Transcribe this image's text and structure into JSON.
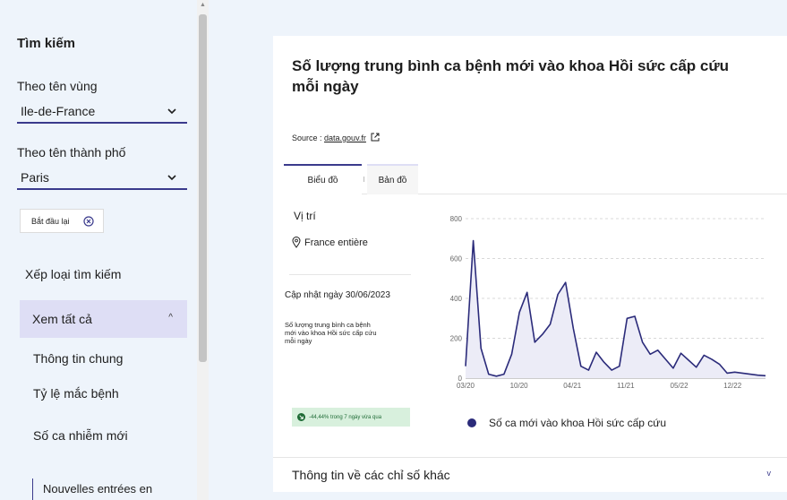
{
  "sidebar": {
    "title": "Tìm kiếm",
    "region_label": "Theo tên vùng",
    "region_value": "Ile-de-France",
    "city_label": "Theo tên thành phố",
    "city_value": "Paris",
    "reset_label": "Bắt đầu lại",
    "ranking_label": "Xếp loại tìm kiếm",
    "accordion_label": "Xem tất cả",
    "items": [
      "Thông tin chung",
      "Tỷ lệ mắc bệnh",
      "Số ca nhiễm mới"
    ],
    "sub_item": "Nouvelles entrées en"
  },
  "card": {
    "title": "Số lượng trung bình ca bệnh mới vào khoa Hồi sức cấp cứu mỗi ngày",
    "source_prefix": "Source : ",
    "source_link": "data.gouv.fr",
    "tabs": [
      "Biểu đồ",
      "Bản đồ"
    ],
    "location_title": "Vị trí",
    "location_value": "France entière",
    "update": "Cập nhật ngày 30/06/2023",
    "description": "Số lượng trung bình ca bệnh mới vào khoa Hồi sức cấp cứu mỗi ngày",
    "trend": "-44,44% trong 7 ngày vừa qua",
    "legend": "Số ca mới vào khoa Hồi sức cấp cứu",
    "bottom_accordion": "Thông tin về các chỉ số khác"
  },
  "colors": {
    "accent": "#3a3a8c",
    "series": "#2b2b7a",
    "accordion_bg": "#dedef5",
    "trend_bg": "#d8f0dd"
  },
  "chart_data": {
    "type": "area",
    "x_ticks": [
      "03/20",
      "10/20",
      "04/21",
      "11/21",
      "05/22",
      "12/22"
    ],
    "y_ticks": [
      0,
      200,
      400,
      600,
      800
    ],
    "ylim": [
      0,
      800
    ],
    "x": [
      "03/20",
      "04/20",
      "05/20",
      "06/20",
      "07/20",
      "08/20",
      "09/20",
      "10/20",
      "11/20",
      "12/20",
      "01/21",
      "02/21",
      "03/21",
      "04/21",
      "05/21",
      "06/21",
      "07/21",
      "08/21",
      "09/21",
      "10/21",
      "11/21",
      "12/21",
      "01/22",
      "02/22",
      "03/22",
      "04/22",
      "05/22",
      "06/22",
      "07/22",
      "08/22",
      "09/22",
      "10/22",
      "11/22",
      "12/22",
      "01/23",
      "02/23",
      "03/23",
      "04/23",
      "05/23",
      "06/23"
    ],
    "values": [
      60,
      690,
      150,
      20,
      10,
      20,
      120,
      330,
      430,
      180,
      220,
      270,
      420,
      480,
      250,
      60,
      40,
      130,
      80,
      40,
      60,
      300,
      310,
      180,
      120,
      140,
      95,
      50,
      125,
      90,
      55,
      115,
      95,
      70,
      25,
      30,
      25,
      20,
      15,
      12
    ],
    "series_name": "Số ca mới vào khoa Hồi sức cấp cứu"
  }
}
